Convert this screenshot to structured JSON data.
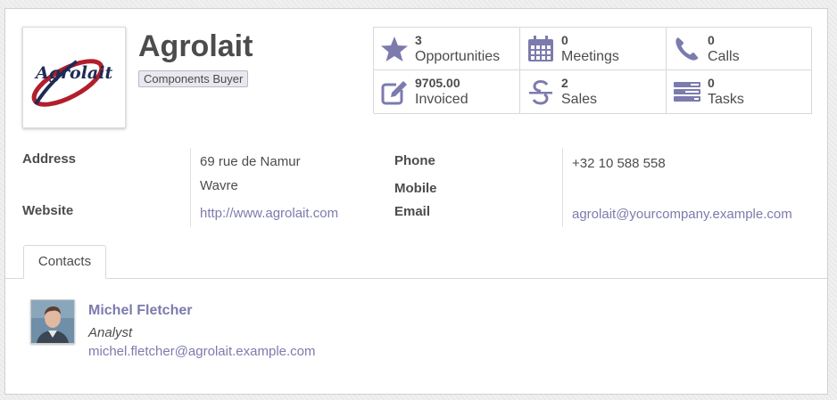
{
  "partner": {
    "name": "Agrolait",
    "tag": "Components Buyer",
    "logo_text": "Agrolait"
  },
  "stats": [
    {
      "value": "3",
      "label": "Opportunities",
      "icon": "star-icon"
    },
    {
      "value": "0",
      "label": "Meetings",
      "icon": "calendar-icon"
    },
    {
      "value": "0",
      "label": "Calls",
      "icon": "phone-icon"
    },
    {
      "value": "9705.00",
      "label": "Invoiced",
      "icon": "pencil-square-icon"
    },
    {
      "value": "2",
      "label": "Sales",
      "icon": "strikethrough-icon"
    },
    {
      "value": "0",
      "label": "Tasks",
      "icon": "tasks-icon"
    }
  ],
  "info": {
    "address_label": "Address",
    "address_line1": "69 rue de Namur",
    "address_line2": "Wavre",
    "website_label": "Website",
    "website": "http://www.agrolait.com",
    "phone_label": "Phone",
    "phone": "+32 10 588 558",
    "mobile_label": "Mobile",
    "email_label": "Email",
    "email": "agrolait@yourcompany.example.com"
  },
  "tabs": {
    "contacts": "Contacts"
  },
  "contact": {
    "name": "Michel Fletcher",
    "function": "Analyst",
    "email": "michel.fletcher@agrolait.example.com"
  },
  "colors": {
    "accent": "#7c7bad",
    "text": "#4c4c4c",
    "logo_red": "#b21e2b",
    "logo_navy": "#1f2a55"
  }
}
